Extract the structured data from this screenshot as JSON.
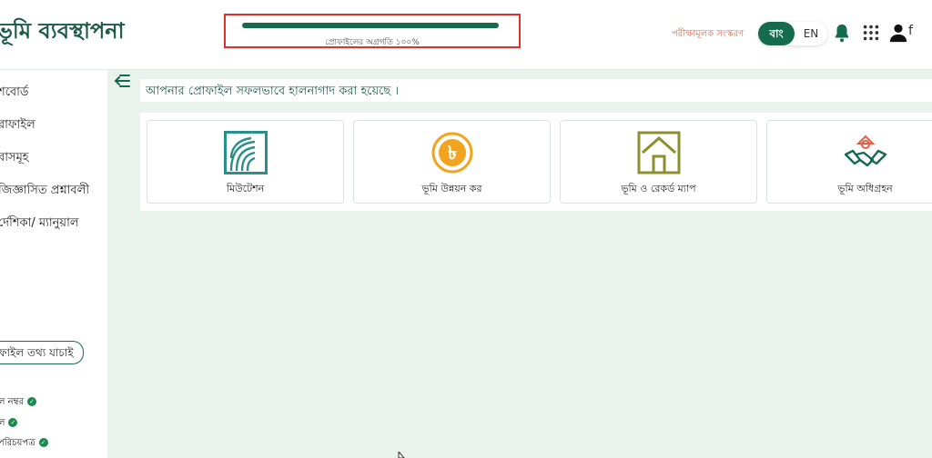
{
  "header": {
    "title": "ভূমি ব্যবস্থাপনা",
    "progress_label": "প্রোফাইলের অগ্রগতি ১০০%",
    "progress_value": 100,
    "trial_label": "পরীক্ষামূলক সংস্করণ",
    "lang_bn": "বাং",
    "lang_en": "EN",
    "user_initial": "f"
  },
  "sidebar": {
    "items": [
      {
        "label": "শবোর্ড"
      },
      {
        "label": "রাফাইল"
      },
      {
        "label": "বাসমূহ"
      },
      {
        "label": "জিজ্ঞাসিত প্রশ্নাবলী"
      },
      {
        "label": "র্দেশিকা/ ম্যানুয়াল"
      }
    ],
    "verify_button": "প্রোফাইল তথ্য যাচাই",
    "checks": [
      {
        "label": "ল নম্বর"
      },
      {
        "label": "ল"
      },
      {
        "label": "পরিচয়পত্র"
      }
    ]
  },
  "main": {
    "success_message": "আপনার প্রোফাইল সফলভাবে হালনাগাদ করা হয়েছে ।",
    "services": [
      {
        "label": "মিউটেশন",
        "icon": "fingerprint-icon",
        "color": "#2a8f8a"
      },
      {
        "label": "ভূমি উন্নয়ন কর",
        "icon": "taka-coin-icon",
        "color": "#f2a41f"
      },
      {
        "label": "ভূমি ও রেকর্ড ম্যাপ",
        "icon": "house-map-icon",
        "color": "#8b8f2e"
      },
      {
        "label": "ভূমি অধিগ্রহন",
        "icon": "handshake-icon",
        "color": "#e2604a"
      }
    ]
  },
  "colors": {
    "brand": "#156b4d",
    "highlight_border": "#e0302a",
    "background": "#e9f2ec"
  }
}
